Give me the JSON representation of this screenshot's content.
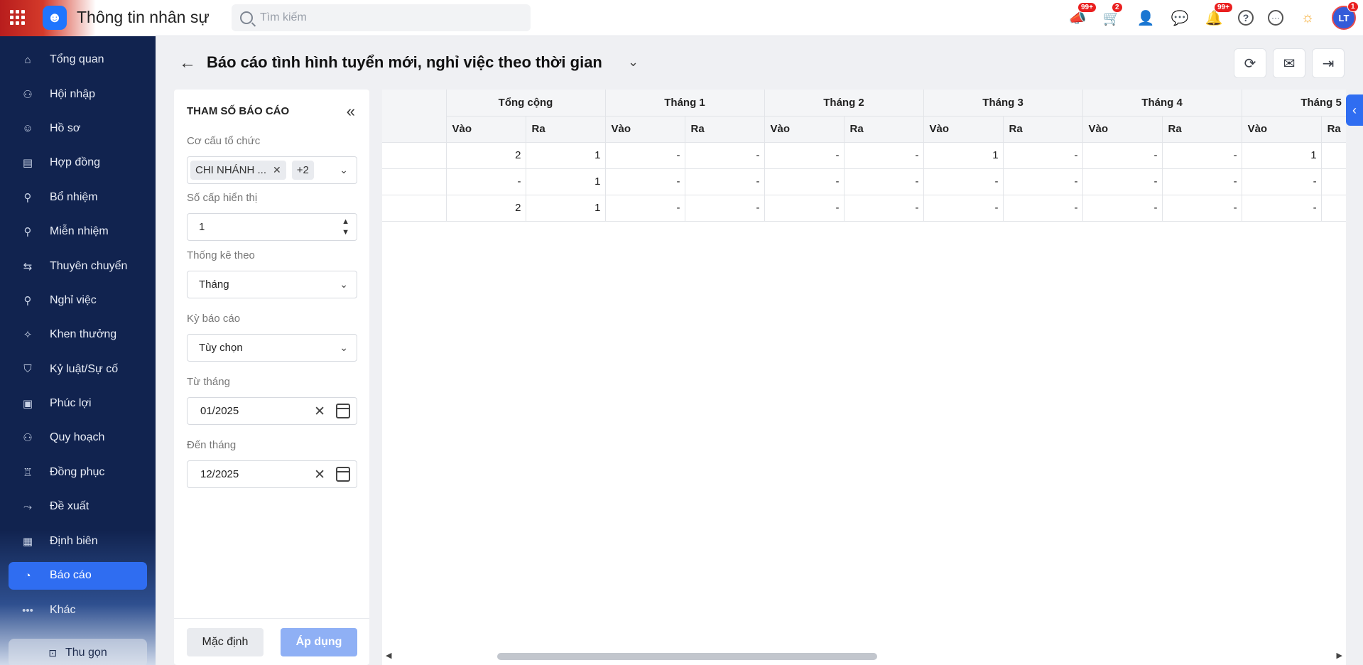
{
  "header": {
    "app_title": "Thông tin nhân sự",
    "search_placeholder": "Tìm kiếm",
    "badges": {
      "announcements": "99+",
      "cart": "2",
      "notifications": "99+",
      "avatar": "1"
    },
    "avatar_initials": "LT"
  },
  "sidebar": {
    "items": [
      {
        "label": "Tổng quan",
        "icon": "home-icon",
        "glyph": "⌂"
      },
      {
        "label": "Hội nhập",
        "icon": "onboarding-icon",
        "glyph": "⚇"
      },
      {
        "label": "Hồ sơ",
        "icon": "profile-icon",
        "glyph": "☺"
      },
      {
        "label": "Hợp đồng",
        "icon": "contract-icon",
        "glyph": "▤"
      },
      {
        "label": "Bổ nhiệm",
        "icon": "appoint-icon",
        "glyph": "⚲"
      },
      {
        "label": "Miễn nhiệm",
        "icon": "dismiss-icon",
        "glyph": "⚲"
      },
      {
        "label": "Thuyên chuyển",
        "icon": "transfer-icon",
        "glyph": "⇆"
      },
      {
        "label": "Nghỉ việc",
        "icon": "resign-icon",
        "glyph": "⚲"
      },
      {
        "label": "Khen thưởng",
        "icon": "reward-icon",
        "glyph": "✧"
      },
      {
        "label": "Kỷ luật/Sự cố",
        "icon": "discipline-icon",
        "glyph": "⛉"
      },
      {
        "label": "Phúc lợi",
        "icon": "welfare-icon",
        "glyph": "▣"
      },
      {
        "label": "Quy hoạch",
        "icon": "planning-icon",
        "glyph": "⚇"
      },
      {
        "label": "Đồng phục",
        "icon": "uniform-icon",
        "glyph": "♖"
      },
      {
        "label": "Đề xuất",
        "icon": "proposal-icon",
        "glyph": "⤳"
      },
      {
        "label": "Định biên",
        "icon": "headcount-icon",
        "glyph": "▦"
      },
      {
        "label": "Báo cáo",
        "icon": "report-icon",
        "glyph": "◔",
        "active": true
      },
      {
        "label": "Khác",
        "icon": "more-icon",
        "glyph": "•••"
      }
    ],
    "collapse_label": "Thu gọn"
  },
  "page": {
    "title": "Báo cáo tình hình tuyển mới, nghỉ việc theo thời gian"
  },
  "params": {
    "heading": "THAM SỐ BÁO CÁO",
    "org_label": "Cơ cấu tổ chức",
    "org_chip": "CHI NHÁNH ...",
    "org_more": "+2",
    "level_label": "Số cấp hiển thị",
    "level_value": "1",
    "stat_label": "Thống kê theo",
    "stat_value": "Tháng",
    "period_label": "Kỳ báo cáo",
    "period_value": "Tùy chọn",
    "from_label": "Từ tháng",
    "from_value": "01/2025",
    "to_label": "Đến tháng",
    "to_value": "12/2025",
    "default_button": "Mặc định",
    "apply_button": "Áp dụng"
  },
  "table": {
    "groups": [
      "Tổng cộng",
      "Tháng 1",
      "Tháng 2",
      "Tháng 3",
      "Tháng 4",
      "Tháng 5"
    ],
    "sub_in": "Vào",
    "sub_out": "Ra",
    "rows": [
      [
        "2",
        "1",
        "-",
        "-",
        "-",
        "-",
        "1",
        "-",
        "-",
        "-",
        "1",
        ""
      ],
      [
        "-",
        "1",
        "-",
        "-",
        "-",
        "-",
        "-",
        "-",
        "-",
        "-",
        "-",
        ""
      ],
      [
        "2",
        "1",
        "-",
        "-",
        "-",
        "-",
        "-",
        "-",
        "-",
        "-",
        "-",
        ""
      ]
    ]
  }
}
